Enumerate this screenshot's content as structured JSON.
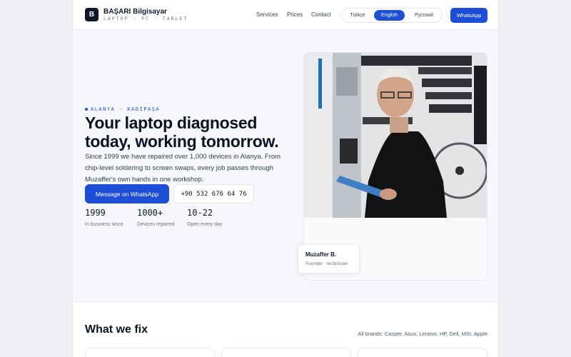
{
  "brand": {
    "logo_letter": "B",
    "name": "BAŞARI Bilgisayar",
    "tagline": "LAPTOP · PC · TABLET"
  },
  "nav": {
    "items": [
      "Services",
      "Prices",
      "Contact"
    ]
  },
  "languages": {
    "options": [
      "Türkçe",
      "English",
      "Русский"
    ],
    "active": "English"
  },
  "header_cta": "WhatsApp",
  "hero": {
    "location": "ALANYA · KADIPAŞA",
    "headline": "Your laptop diagnosed today, working tomorrow.",
    "lead": "Since 1999 we have repaired over 1,000 devices in Alanya. From chip-level soldering to screen swaps, every job passes through Muzaffer's own hands in one workshop.",
    "primary_cta": "Message on WhatsApp",
    "phone": "+90 532 676 64 76",
    "stats": [
      {
        "value": "1999",
        "label": "In business since"
      },
      {
        "value": "1000+",
        "label": "Devices repaired"
      },
      {
        "value": "10-22",
        "label": "Open every day"
      }
    ]
  },
  "founder": {
    "name": "Muzaffer B.",
    "role": "Founder · technician"
  },
  "services": {
    "title": "What we fix",
    "brands": "All brands: Casper, Asus, Lenovo, HP, Dell, MSI, Apple"
  },
  "colors": {
    "accent": "#1d4ed8",
    "ink": "#0b1220",
    "muted": "#6b7280"
  }
}
